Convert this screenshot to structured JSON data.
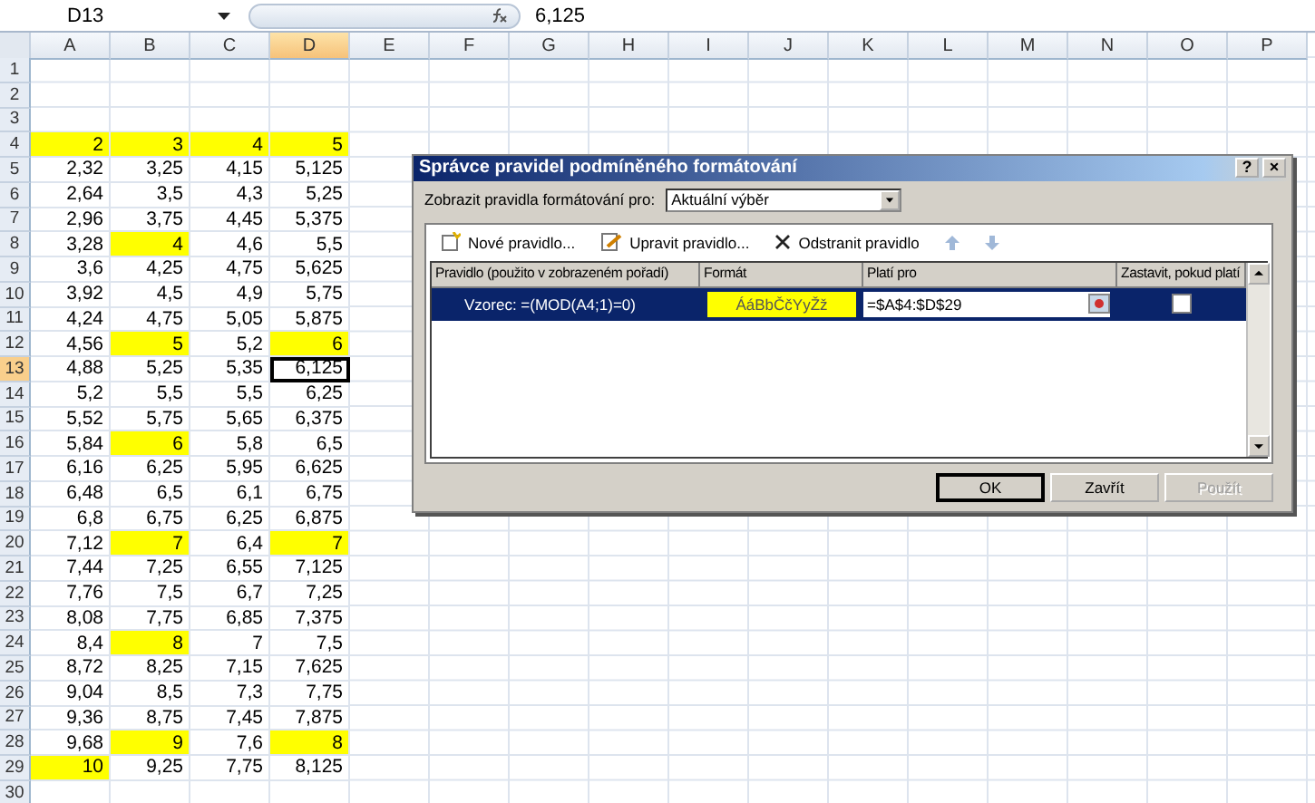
{
  "formula_bar": {
    "name_box": "D13",
    "formula": "6,125"
  },
  "columns": [
    {
      "label": "A",
      "selected": false
    },
    {
      "label": "B",
      "selected": false
    },
    {
      "label": "C",
      "selected": false
    },
    {
      "label": "D",
      "selected": true
    },
    {
      "label": "E",
      "selected": false
    },
    {
      "label": "F",
      "selected": false
    },
    {
      "label": "G",
      "selected": false
    },
    {
      "label": "H",
      "selected": false
    },
    {
      "label": "I",
      "selected": false
    },
    {
      "label": "J",
      "selected": false
    },
    {
      "label": "K",
      "selected": false
    },
    {
      "label": "L",
      "selected": false
    },
    {
      "label": "M",
      "selected": false
    },
    {
      "label": "N",
      "selected": false
    },
    {
      "label": "O",
      "selected": false
    },
    {
      "label": "P",
      "selected": false
    }
  ],
  "rows": [
    {
      "number": "1",
      "selected": false,
      "cells": []
    },
    {
      "number": "2",
      "selected": false,
      "cells": []
    },
    {
      "number": "3",
      "selected": false,
      "cells": []
    },
    {
      "number": "4",
      "selected": false,
      "cells": [
        {
          "text": "2",
          "highlighted": true,
          "selected": false
        },
        {
          "text": "3",
          "highlighted": true,
          "selected": false
        },
        {
          "text": "4",
          "highlighted": true,
          "selected": false
        },
        {
          "text": "5",
          "highlighted": true,
          "selected": false
        }
      ]
    },
    {
      "number": "5",
      "selected": false,
      "cells": [
        {
          "text": "2,32",
          "highlighted": false,
          "selected": false
        },
        {
          "text": "3,25",
          "highlighted": false,
          "selected": false
        },
        {
          "text": "4,15",
          "highlighted": false,
          "selected": false
        },
        {
          "text": "5,125",
          "highlighted": false,
          "selected": false
        }
      ]
    },
    {
      "number": "6",
      "selected": false,
      "cells": [
        {
          "text": "2,64",
          "highlighted": false,
          "selected": false
        },
        {
          "text": "3,5",
          "highlighted": false,
          "selected": false
        },
        {
          "text": "4,3",
          "highlighted": false,
          "selected": false
        },
        {
          "text": "5,25",
          "highlighted": false,
          "selected": false
        }
      ]
    },
    {
      "number": "7",
      "selected": false,
      "cells": [
        {
          "text": "2,96",
          "highlighted": false,
          "selected": false
        },
        {
          "text": "3,75",
          "highlighted": false,
          "selected": false
        },
        {
          "text": "4,45",
          "highlighted": false,
          "selected": false
        },
        {
          "text": "5,375",
          "highlighted": false,
          "selected": false
        }
      ]
    },
    {
      "number": "8",
      "selected": false,
      "cells": [
        {
          "text": "3,28",
          "highlighted": false,
          "selected": false
        },
        {
          "text": "4",
          "highlighted": true,
          "selected": false
        },
        {
          "text": "4,6",
          "highlighted": false,
          "selected": false
        },
        {
          "text": "5,5",
          "highlighted": false,
          "selected": false
        }
      ]
    },
    {
      "number": "9",
      "selected": false,
      "cells": [
        {
          "text": "3,6",
          "highlighted": false,
          "selected": false
        },
        {
          "text": "4,25",
          "highlighted": false,
          "selected": false
        },
        {
          "text": "4,75",
          "highlighted": false,
          "selected": false
        },
        {
          "text": "5,625",
          "highlighted": false,
          "selected": false
        }
      ]
    },
    {
      "number": "10",
      "selected": false,
      "cells": [
        {
          "text": "3,92",
          "highlighted": false,
          "selected": false
        },
        {
          "text": "4,5",
          "highlighted": false,
          "selected": false
        },
        {
          "text": "4,9",
          "highlighted": false,
          "selected": false
        },
        {
          "text": "5,75",
          "highlighted": false,
          "selected": false
        }
      ]
    },
    {
      "number": "11",
      "selected": false,
      "cells": [
        {
          "text": "4,24",
          "highlighted": false,
          "selected": false
        },
        {
          "text": "4,75",
          "highlighted": false,
          "selected": false
        },
        {
          "text": "5,05",
          "highlighted": false,
          "selected": false
        },
        {
          "text": "5,875",
          "highlighted": false,
          "selected": false
        }
      ]
    },
    {
      "number": "12",
      "selected": false,
      "cells": [
        {
          "text": "4,56",
          "highlighted": false,
          "selected": false
        },
        {
          "text": "5",
          "highlighted": true,
          "selected": false
        },
        {
          "text": "5,2",
          "highlighted": false,
          "selected": false
        },
        {
          "text": "6",
          "highlighted": true,
          "selected": false
        }
      ]
    },
    {
      "number": "13",
      "selected": true,
      "cells": [
        {
          "text": "4,88",
          "highlighted": false,
          "selected": false
        },
        {
          "text": "5,25",
          "highlighted": false,
          "selected": false
        },
        {
          "text": "5,35",
          "highlighted": false,
          "selected": false
        },
        {
          "text": "6,125",
          "highlighted": false,
          "selected": true
        }
      ]
    },
    {
      "number": "14",
      "selected": false,
      "cells": [
        {
          "text": "5,2",
          "highlighted": false,
          "selected": false
        },
        {
          "text": "5,5",
          "highlighted": false,
          "selected": false
        },
        {
          "text": "5,5",
          "highlighted": false,
          "selected": false
        },
        {
          "text": "6,25",
          "highlighted": false,
          "selected": false
        }
      ]
    },
    {
      "number": "15",
      "selected": false,
      "cells": [
        {
          "text": "5,52",
          "highlighted": false,
          "selected": false
        },
        {
          "text": "5,75",
          "highlighted": false,
          "selected": false
        },
        {
          "text": "5,65",
          "highlighted": false,
          "selected": false
        },
        {
          "text": "6,375",
          "highlighted": false,
          "selected": false
        }
      ]
    },
    {
      "number": "16",
      "selected": false,
      "cells": [
        {
          "text": "5,84",
          "highlighted": false,
          "selected": false
        },
        {
          "text": "6",
          "highlighted": true,
          "selected": false
        },
        {
          "text": "5,8",
          "highlighted": false,
          "selected": false
        },
        {
          "text": "6,5",
          "highlighted": false,
          "selected": false
        }
      ]
    },
    {
      "number": "17",
      "selected": false,
      "cells": [
        {
          "text": "6,16",
          "highlighted": false,
          "selected": false
        },
        {
          "text": "6,25",
          "highlighted": false,
          "selected": false
        },
        {
          "text": "5,95",
          "highlighted": false,
          "selected": false
        },
        {
          "text": "6,625",
          "highlighted": false,
          "selected": false
        }
      ]
    },
    {
      "number": "18",
      "selected": false,
      "cells": [
        {
          "text": "6,48",
          "highlighted": false,
          "selected": false
        },
        {
          "text": "6,5",
          "highlighted": false,
          "selected": false
        },
        {
          "text": "6,1",
          "highlighted": false,
          "selected": false
        },
        {
          "text": "6,75",
          "highlighted": false,
          "selected": false
        }
      ]
    },
    {
      "number": "19",
      "selected": false,
      "cells": [
        {
          "text": "6,8",
          "highlighted": false,
          "selected": false
        },
        {
          "text": "6,75",
          "highlighted": false,
          "selected": false
        },
        {
          "text": "6,25",
          "highlighted": false,
          "selected": false
        },
        {
          "text": "6,875",
          "highlighted": false,
          "selected": false
        }
      ]
    },
    {
      "number": "20",
      "selected": false,
      "cells": [
        {
          "text": "7,12",
          "highlighted": false,
          "selected": false
        },
        {
          "text": "7",
          "highlighted": true,
          "selected": false
        },
        {
          "text": "6,4",
          "highlighted": false,
          "selected": false
        },
        {
          "text": "7",
          "highlighted": true,
          "selected": false
        }
      ]
    },
    {
      "number": "21",
      "selected": false,
      "cells": [
        {
          "text": "7,44",
          "highlighted": false,
          "selected": false
        },
        {
          "text": "7,25",
          "highlighted": false,
          "selected": false
        },
        {
          "text": "6,55",
          "highlighted": false,
          "selected": false
        },
        {
          "text": "7,125",
          "highlighted": false,
          "selected": false
        }
      ]
    },
    {
      "number": "22",
      "selected": false,
      "cells": [
        {
          "text": "7,76",
          "highlighted": false,
          "selected": false
        },
        {
          "text": "7,5",
          "highlighted": false,
          "selected": false
        },
        {
          "text": "6,7",
          "highlighted": false,
          "selected": false
        },
        {
          "text": "7,25",
          "highlighted": false,
          "selected": false
        }
      ]
    },
    {
      "number": "23",
      "selected": false,
      "cells": [
        {
          "text": "8,08",
          "highlighted": false,
          "selected": false
        },
        {
          "text": "7,75",
          "highlighted": false,
          "selected": false
        },
        {
          "text": "6,85",
          "highlighted": false,
          "selected": false
        },
        {
          "text": "7,375",
          "highlighted": false,
          "selected": false
        }
      ]
    },
    {
      "number": "24",
      "selected": false,
      "cells": [
        {
          "text": "8,4",
          "highlighted": false,
          "selected": false
        },
        {
          "text": "8",
          "highlighted": true,
          "selected": false
        },
        {
          "text": "7",
          "highlighted": false,
          "selected": false
        },
        {
          "text": "7,5",
          "highlighted": false,
          "selected": false
        }
      ]
    },
    {
      "number": "25",
      "selected": false,
      "cells": [
        {
          "text": "8,72",
          "highlighted": false,
          "selected": false
        },
        {
          "text": "8,25",
          "highlighted": false,
          "selected": false
        },
        {
          "text": "7,15",
          "highlighted": false,
          "selected": false
        },
        {
          "text": "7,625",
          "highlighted": false,
          "selected": false
        }
      ]
    },
    {
      "number": "26",
      "selected": false,
      "cells": [
        {
          "text": "9,04",
          "highlighted": false,
          "selected": false
        },
        {
          "text": "8,5",
          "highlighted": false,
          "selected": false
        },
        {
          "text": "7,3",
          "highlighted": false,
          "selected": false
        },
        {
          "text": "7,75",
          "highlighted": false,
          "selected": false
        }
      ]
    },
    {
      "number": "27",
      "selected": false,
      "cells": [
        {
          "text": "9,36",
          "highlighted": false,
          "selected": false
        },
        {
          "text": "8,75",
          "highlighted": false,
          "selected": false
        },
        {
          "text": "7,45",
          "highlighted": false,
          "selected": false
        },
        {
          "text": "7,875",
          "highlighted": false,
          "selected": false
        }
      ]
    },
    {
      "number": "28",
      "selected": false,
      "cells": [
        {
          "text": "9,68",
          "highlighted": false,
          "selected": false
        },
        {
          "text": "9",
          "highlighted": true,
          "selected": false
        },
        {
          "text": "7,6",
          "highlighted": false,
          "selected": false
        },
        {
          "text": "8",
          "highlighted": true,
          "selected": false
        }
      ]
    },
    {
      "number": "29",
      "selected": false,
      "cells": [
        {
          "text": "10",
          "highlighted": true,
          "selected": false
        },
        {
          "text": "9,25",
          "highlighted": false,
          "selected": false
        },
        {
          "text": "7,75",
          "highlighted": false,
          "selected": false
        },
        {
          "text": "8,125",
          "highlighted": false,
          "selected": false
        }
      ]
    },
    {
      "number": "30",
      "selected": false,
      "cells": []
    }
  ],
  "dialog": {
    "title": "Správce pravidel podmíněného formátování",
    "help": "?",
    "close": "×",
    "scope_label": "Zobrazit pravidla formátování pro:",
    "scope_value": "Aktuální výběr",
    "toolbar": [
      {
        "kind": "new",
        "label": "Nové pravidlo...",
        "disabled": false
      },
      {
        "kind": "edit",
        "label": "Upravit pravidlo...",
        "disabled": false
      },
      {
        "kind": "delete",
        "label": "Odstranit pravidlo",
        "disabled": false
      },
      {
        "kind": "up",
        "disabled": true
      },
      {
        "kind": "down",
        "disabled": true
      }
    ],
    "columns": [
      "Pravidlo (použito v zobrazeném pořadí)",
      "Formát",
      "Platí pro",
      "Zastavit, pokud platí"
    ],
    "rules": [
      {
        "rule": "Vzorec: =(MOD(A4;1)=0)",
        "format_preview": "ÁáBbČčYyŽž",
        "applies_to": "=$A$4:$D$29",
        "stop_if_true": false,
        "selected": true
      }
    ],
    "buttons": [
      {
        "label": "OK",
        "disabled": false,
        "default": true
      },
      {
        "label": "Zavřít",
        "disabled": false,
        "default": false
      },
      {
        "label": "Použít",
        "disabled": true,
        "default": false
      }
    ]
  }
}
